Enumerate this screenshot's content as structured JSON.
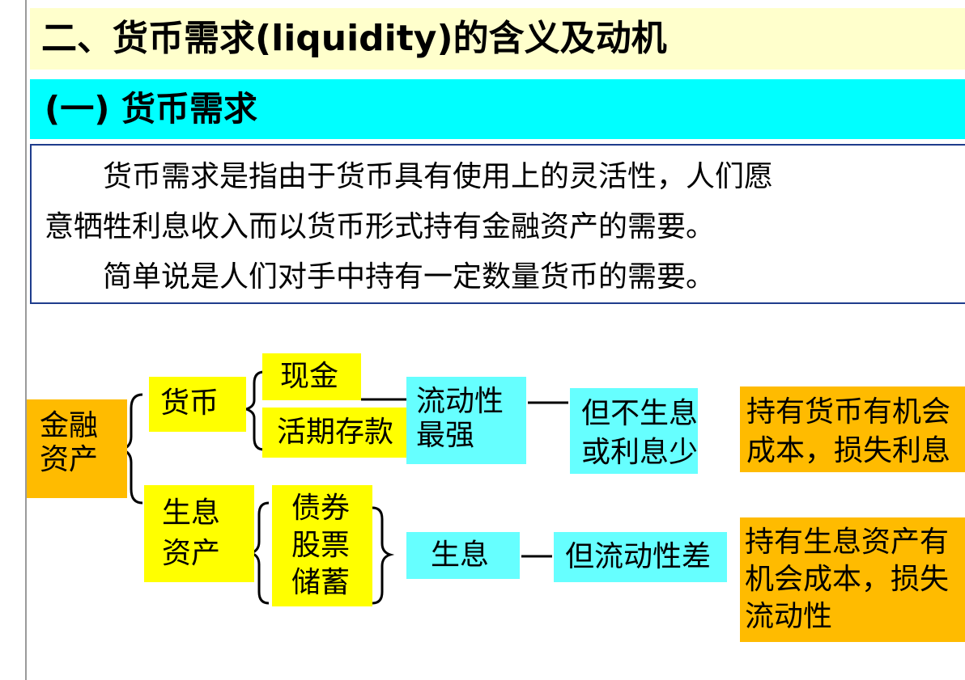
{
  "header": {
    "title": "二、货币需求(liquidity)的含义及动机",
    "subtitle": "(一) 货币需求"
  },
  "definition": {
    "line1": "货币需求是指由于货币具有使用上的灵活性，人们愿",
    "line2": "意牺牲利息收入而以货币形式持有金融资产的需要。",
    "line3": "简单说是人们对手中持有一定数量货币的需要。"
  },
  "diagram": {
    "root": {
      "line1": "金融",
      "line2": "资产"
    },
    "money": {
      "label": "货币",
      "items": [
        "现金",
        "活期存款"
      ],
      "property": {
        "line1": "流动性",
        "line2": "最强"
      },
      "tradeoff": {
        "line1": "但不生息",
        "line2": "或利息少"
      },
      "cost": {
        "line1": "持有货币有机会",
        "line2": "成本，损失利息"
      }
    },
    "interest_assets": {
      "label_line1": "生息",
      "label_line2": "资产",
      "items": [
        "债券",
        "股票",
        "储蓄"
      ],
      "property": "生息",
      "tradeoff": "但流动性差",
      "cost": {
        "line1": "持有生息资产有",
        "line2": "机会成本，损失",
        "line3": "流动性"
      }
    },
    "colors": {
      "yellow": "#ffff00",
      "cyan": "#66ffff",
      "orange": "#ffbb00"
    }
  }
}
